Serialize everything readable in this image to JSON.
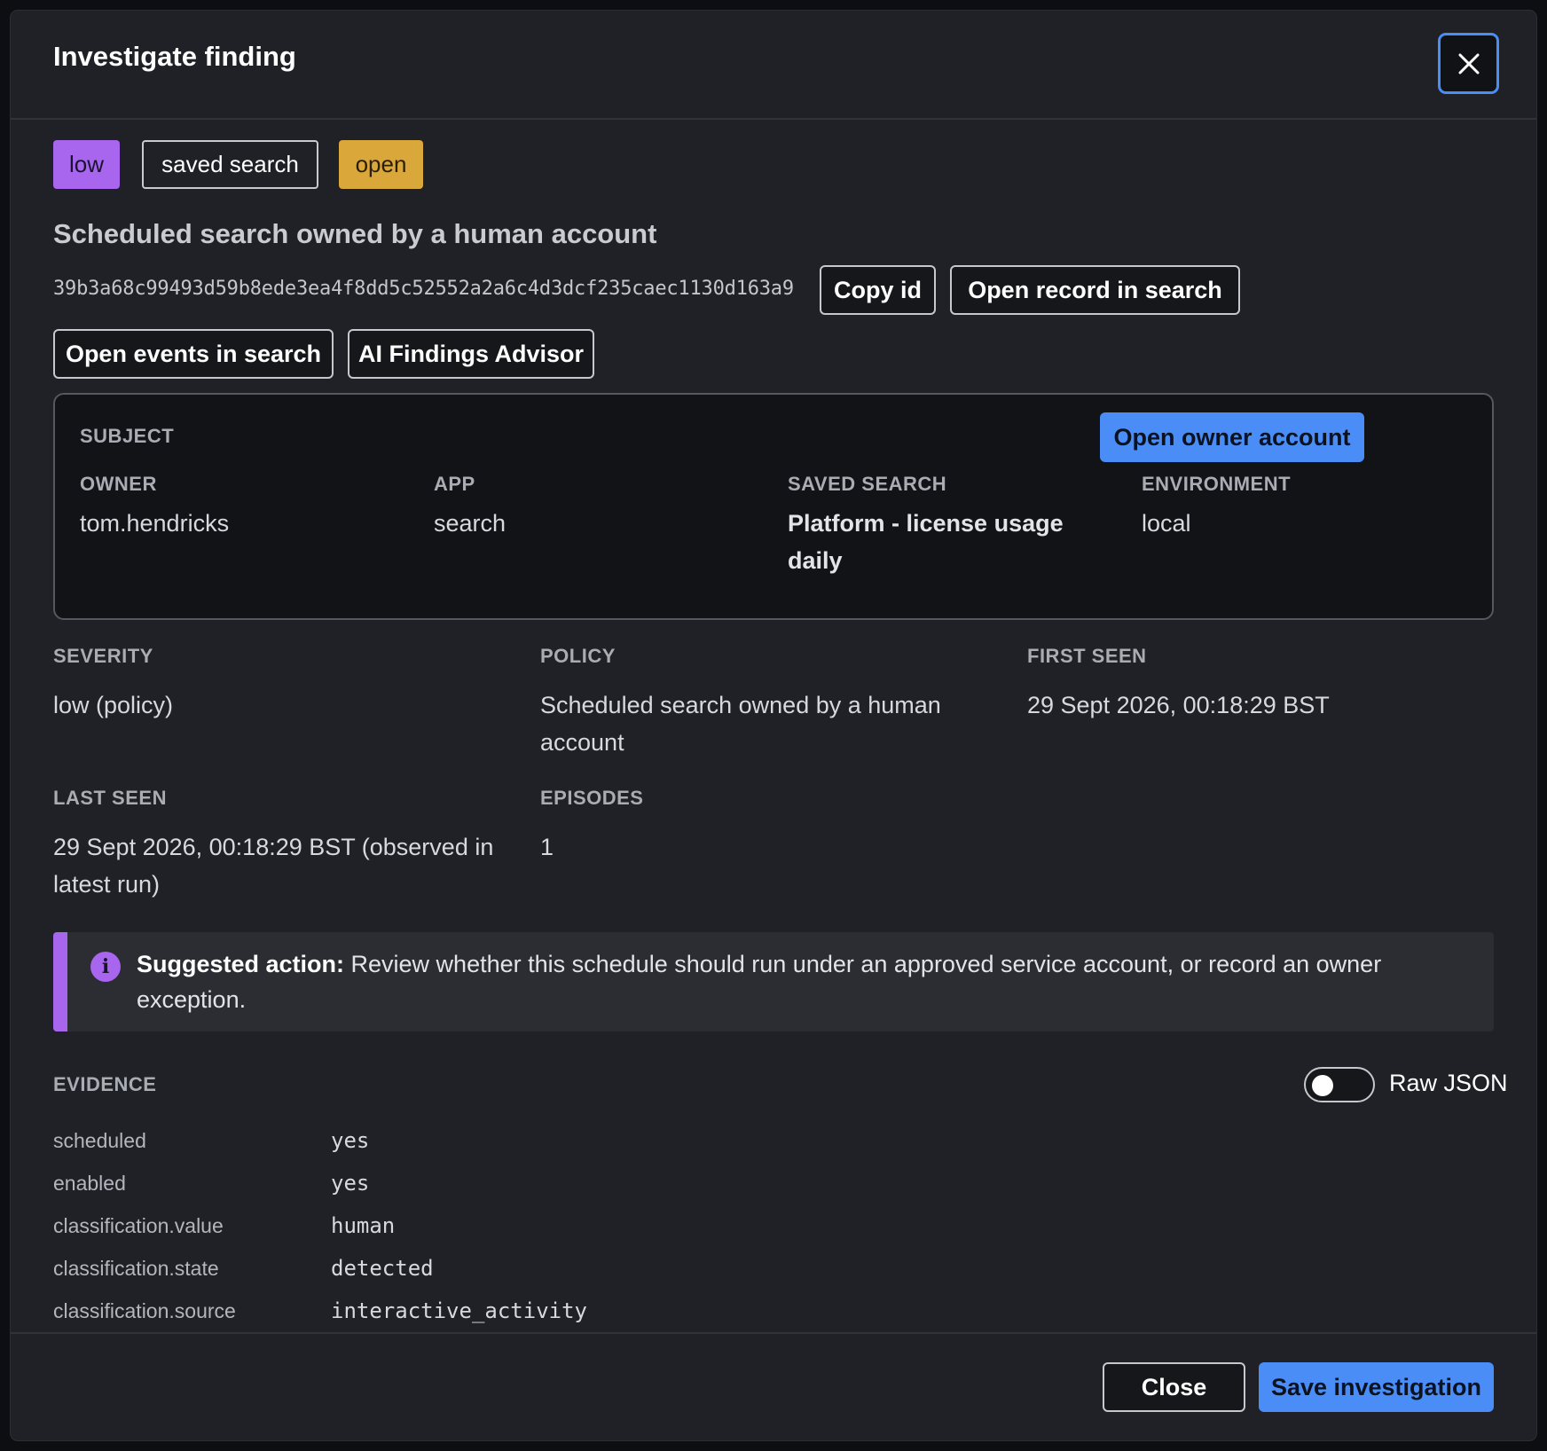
{
  "modal": {
    "title": "Investigate finding",
    "close_icon": "close-icon"
  },
  "badges": {
    "severity": "low",
    "type": "saved search",
    "status": "open"
  },
  "finding": {
    "title": "Scheduled search owned by a human account",
    "id": "39b3a68c99493d59b8ede3ea4f8dd5c52552a2a6c4d3dcf235caec1130d163a9",
    "copy_label": "Copy id",
    "open_record_label": "Open record in search",
    "open_events_label": "Open events in search",
    "ai_label": "AI Findings Advisor"
  },
  "subject": {
    "heading": "SUBJECT",
    "open_owner_label": "Open owner account",
    "fields": [
      {
        "label": "OWNER",
        "value": "tom.hendricks"
      },
      {
        "label": "APP",
        "value": "search"
      },
      {
        "label": "SAVED SEARCH",
        "value": "Platform - license usage daily"
      },
      {
        "label": "ENVIRONMENT",
        "value": "local"
      }
    ]
  },
  "details": [
    {
      "label": "SEVERITY",
      "value": "low (policy)"
    },
    {
      "label": "POLICY",
      "value": "Scheduled search owned by a human account"
    },
    {
      "label": "FIRST SEEN",
      "value": "29 Sept 2026, 00:18:29 BST"
    },
    {
      "label": "LAST SEEN",
      "value": "29 Sept 2026, 00:18:29 BST (observed in latest run)"
    },
    {
      "label": "EPISODES",
      "value": "1"
    }
  ],
  "suggestion": {
    "icon": "info-icon",
    "lead": "Suggested action:",
    "text": " Review whether this schedule should run under an approved service account, or record an owner exception."
  },
  "evidence": {
    "heading": "EVIDENCE",
    "raw_json_label": "Raw JSON",
    "raw_json_enabled": false,
    "rows": [
      {
        "key": "scheduled",
        "value": "yes"
      },
      {
        "key": "enabled",
        "value": "yes"
      },
      {
        "key": "classification.value",
        "value": "human"
      },
      {
        "key": "classification.state",
        "value": "detected"
      },
      {
        "key": "classification.source",
        "value": "interactive_activity"
      }
    ]
  },
  "footer": {
    "close_label": "Close",
    "save_label": "Save investigation"
  }
}
